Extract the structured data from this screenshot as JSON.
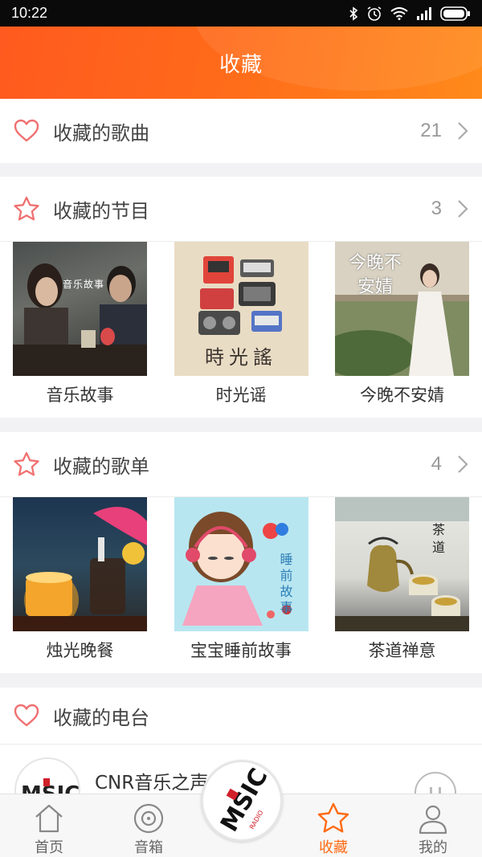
{
  "status_bar": {
    "time": "10:22"
  },
  "header": {
    "title": "收藏"
  },
  "songs": {
    "label": "收藏的歌曲",
    "count": "21"
  },
  "programs": {
    "label": "收藏的节目",
    "count": "3",
    "items": [
      {
        "title": "音乐故事",
        "cover_text": "音乐故事"
      },
      {
        "title": "时光谣",
        "cover_text": "時光謠"
      },
      {
        "title": "今晚不安婧",
        "cover_text": "今晚不安婧"
      }
    ]
  },
  "playlists": {
    "label": "收藏的歌单",
    "count": "4",
    "items": [
      {
        "title": "烛光晚餐"
      },
      {
        "title": "宝宝睡前故事",
        "cover_text": "睡前故事"
      },
      {
        "title": "茶道禅意",
        "cover_text": "茶道"
      }
    ]
  },
  "radio": {
    "label": "收藏的电台",
    "station": "CNR音乐之声"
  },
  "nav": {
    "home": "首页",
    "speaker": "音箱",
    "favorites": "收藏",
    "mine": "我的"
  },
  "colors": {
    "accent": "#ff6a13",
    "heart": "#f07070"
  }
}
